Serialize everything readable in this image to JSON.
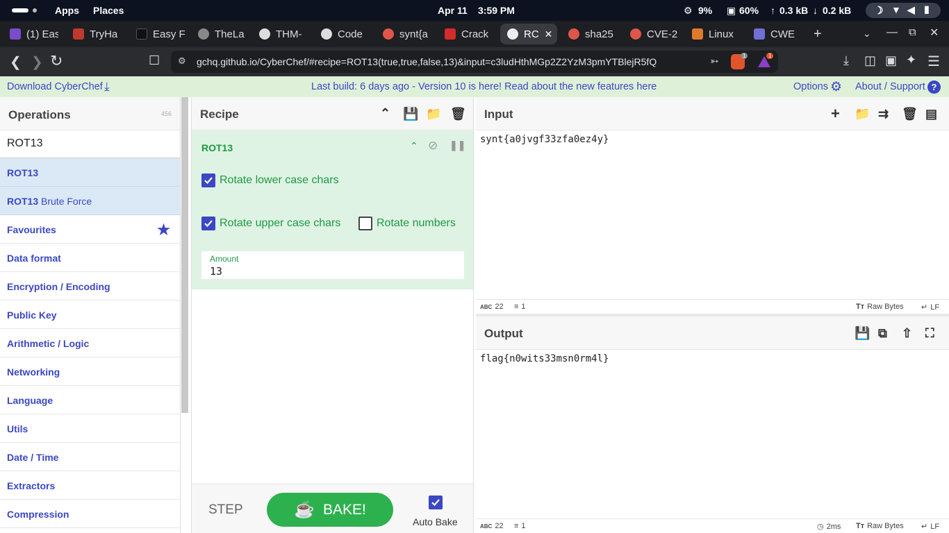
{
  "os_bar": {
    "apps": "Apps",
    "places": "Places",
    "date": "Apr 11",
    "time": "3:59 PM",
    "cpu": "9%",
    "mem": "60%",
    "up": "0.3 kB",
    "down": "0.2 kB"
  },
  "tabs": [
    {
      "label": "(1) Eas",
      "color": "#7a4cc9"
    },
    {
      "label": "TryHa",
      "color": "#c0392b"
    },
    {
      "label": "Easy F",
      "color": "#111111"
    },
    {
      "label": "TheLa",
      "color": "#888888"
    },
    {
      "label": "THM-",
      "color": "#dddddd"
    },
    {
      "label": "Code",
      "color": "#dddddd"
    },
    {
      "label": "synt{a",
      "color": "#e0554a"
    },
    {
      "label": "Crack",
      "color": "#d62b2b"
    },
    {
      "label": "RC",
      "color": "#eeeeee"
    },
    {
      "label": "sha25",
      "color": "#e0554a"
    },
    {
      "label": "CVE-2",
      "color": "#e0554a"
    },
    {
      "label": "Linux",
      "color": "#e07a2b"
    },
    {
      "label": "CWE",
      "color": "#6f6fd6"
    }
  ],
  "address": {
    "url": "gchq.github.io/CyberChef/#recipe=ROT13(true,true,false,13)&input=c3ludHthMGp2Z2YzM3pmYTBlejR5fQ",
    "brave_badge": "1",
    "alert_badge": "1"
  },
  "banner": {
    "download": "Download CyberChef",
    "build": "Last build: 6 days ago - Version 10 is here! Read about the new features here",
    "options": "Options",
    "about": "About / Support"
  },
  "operations": {
    "title": "Operations",
    "count": "456",
    "search": "ROT13",
    "results": [
      {
        "match": "ROT13",
        "rest": ""
      },
      {
        "match": "ROT13",
        "rest": " Brute Force"
      }
    ],
    "categories": [
      "Favourites",
      "Data format",
      "Encryption / Encoding",
      "Public Key",
      "Arithmetic / Logic",
      "Networking",
      "Language",
      "Utils",
      "Date / Time",
      "Extractors",
      "Compression"
    ]
  },
  "recipe": {
    "title": "Recipe",
    "op_name": "ROT13",
    "rotate_lower": "Rotate lower case chars",
    "rotate_upper": "Rotate upper case chars",
    "rotate_numbers": "Rotate numbers",
    "amount_label": "Amount",
    "amount_value": "13",
    "step": "STEP",
    "bake": "BAKE!",
    "auto_bake": "Auto Bake"
  },
  "input": {
    "title": "Input",
    "text": "synt{a0jvgf33zfa0ez4y}",
    "chars": "22",
    "lines": "1",
    "encoding": "Raw Bytes",
    "eol": "LF"
  },
  "output": {
    "title": "Output",
    "text": "flag{n0wits33msn0rm4l}",
    "chars": "22",
    "lines": "1",
    "time": "2ms",
    "encoding": "Raw Bytes",
    "eol": "LF"
  },
  "colors": {
    "accent": "#3b47c4",
    "green": "#1d9942",
    "banner_bg": "#dff0d8",
    "op_bg": "#dff3e4",
    "bake": "#2db14f"
  }
}
